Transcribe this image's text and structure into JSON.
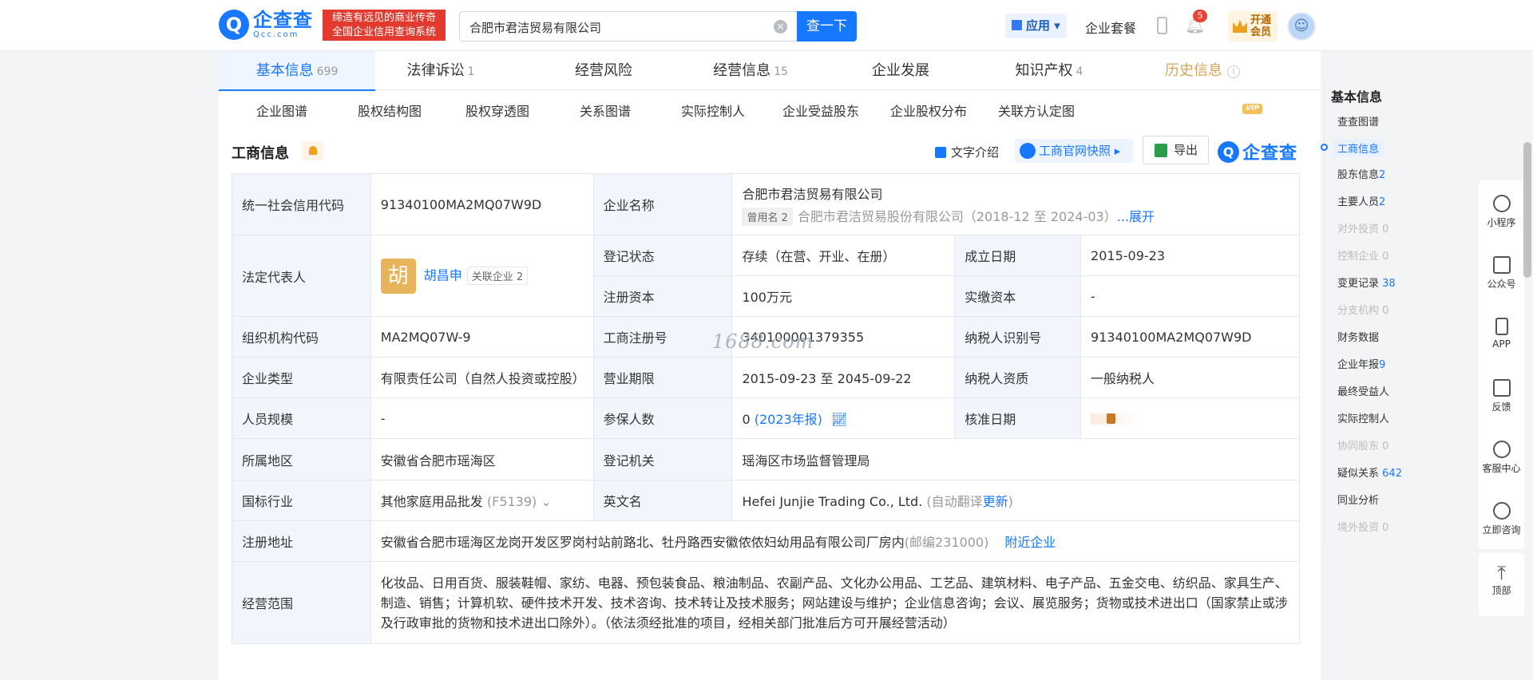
{
  "header": {
    "logo_cn": "企查查",
    "logo_en": "Qcc.com",
    "slogan_line1": "缔造有远见的商业传奇",
    "slogan_line2": "全国企业信用查询系统",
    "search_value": "合肥市君洁贸易有限公司",
    "search_button": "查一下",
    "app_label": "应用",
    "package_label": "企业套餐",
    "notification_count": "5",
    "vip_line1": "开通",
    "vip_line2": "会员"
  },
  "tabs": [
    {
      "label": "基本信息",
      "count": "699"
    },
    {
      "label": "法律诉讼",
      "count": "1"
    },
    {
      "label": "经营风险",
      "count": ""
    },
    {
      "label": "经营信息",
      "count": "15"
    },
    {
      "label": "企业发展",
      "count": ""
    },
    {
      "label": "知识产权",
      "count": "4"
    },
    {
      "label": "历史信息",
      "count": ""
    }
  ],
  "vip_tag": "VIP",
  "subtabs": [
    "企业图谱",
    "股权结构图",
    "股权穿透图",
    "关系图谱",
    "实际控制人",
    "企业受益股东",
    "企业股权分布",
    "关联方认定图"
  ],
  "section": {
    "title": "工商信息",
    "text_intro": "文字介绍",
    "snapshot": "工商官网快照",
    "export": "导出",
    "brand": "企查查"
  },
  "info": {
    "credit_code_label": "统一社会信用代码",
    "credit_code": "91340100MA2MQ07W9D",
    "company_name_label": "企业名称",
    "company_name": "合肥市君洁贸易有限公司",
    "former_tag": "曾用名 2",
    "former_name": "合肥市君洁贸易股份有限公司（2018-12 至 2024-03）",
    "former_more": "...展开",
    "legal_rep_label": "法定代表人",
    "legal_rep_avatar": "胡",
    "legal_rep": "胡昌申",
    "related_tag": "关联企业 2",
    "reg_status_label": "登记状态",
    "reg_status": "存续（在营、开业、在册）",
    "founded_label": "成立日期",
    "founded": "2015-09-23",
    "reg_capital_label": "注册资本",
    "reg_capital": "100万元",
    "paid_capital_label": "实缴资本",
    "paid_capital": "-",
    "org_code_label": "组织机构代码",
    "org_code": "MA2MQ07W-9",
    "reg_no_label": "工商注册号",
    "reg_no": "340100001379355",
    "taxpayer_id_label": "纳税人识别号",
    "taxpayer_id": "91340100MA2MQ07W9D",
    "type_label": "企业类型",
    "type": "有限责任公司（自然人投资或控股）",
    "term_label": "营业期限",
    "term": "2015-09-23 至 2045-09-22",
    "taxpayer_qual_label": "纳税人资质",
    "taxpayer_qual": "一般纳税人",
    "staff_label": "人员规模",
    "staff": "-",
    "insured_label": "参保人数",
    "insured": "0",
    "insured_year": "(2023年报)",
    "approved_label": "核准日期",
    "region_label": "所属地区",
    "region": "安徽省合肥市瑶海区",
    "authority_label": "登记机关",
    "authority": "瑶海区市场监督管理局",
    "industry_label": "国标行业",
    "industry": "其他家庭用品批发",
    "industry_code": "(F5139)",
    "en_name_label": "英文名",
    "en_name": "Hefei Junjie Trading Co., Ltd.",
    "en_auto": "(自动翻译",
    "en_update": "更新",
    "en_close": ")",
    "address_label": "注册地址",
    "address": "安徽省合肥市瑶海区龙岗开发区罗岗村站前路北、牡丹路西安徽侬侬妇幼用品有限公司厂房内",
    "postcode": "(邮编231000)",
    "nearby": "附近企业",
    "scope_label": "经营范围",
    "scope": "化妆品、日用百货、服装鞋帽、家纺、电器、预包装食品、粮油制品、农副产品、文化办公用品、工艺品、建筑材料、电子产品、五金交电、纺织品、家具生产、制造、销售；计算机软、硬件技术开发、技术咨询、技术转让及技术服务；网站建设与维护；企业信息咨询；会议、展览服务；货物或技术进出口（国家禁止或涉及行政审批的货物和技术进出口除外）。（依法须经批准的项目，经相关部门批准后方可开展经营活动）"
  },
  "watermark": "1688.com",
  "right_nav": {
    "title": "基本信息",
    "items": [
      {
        "label": "查查图谱",
        "count": ""
      },
      {
        "label": "工商信息",
        "count": ""
      },
      {
        "label": "股东信息",
        "count": "2"
      },
      {
        "label": "主要人员",
        "count": "2"
      },
      {
        "label": "对外投资",
        "count": "0"
      },
      {
        "label": "控制企业",
        "count": "0"
      },
      {
        "label": "变更记录",
        "count": "38"
      },
      {
        "label": "分支机构",
        "count": "0"
      },
      {
        "label": "财务数据",
        "count": ""
      },
      {
        "label": "企业年报",
        "count": "9"
      },
      {
        "label": "最终受益人",
        "count": ""
      },
      {
        "label": "实际控制人",
        "count": ""
      },
      {
        "label": "协同股东",
        "count": "0"
      },
      {
        "label": "疑似关系",
        "count": "642"
      },
      {
        "label": "同业分析",
        "count": ""
      },
      {
        "label": "境外投资",
        "count": "0"
      }
    ]
  },
  "side_tools": [
    "小程序",
    "公众号",
    "APP",
    "反馈",
    "客服中心",
    "立即咨询",
    "顶部"
  ]
}
